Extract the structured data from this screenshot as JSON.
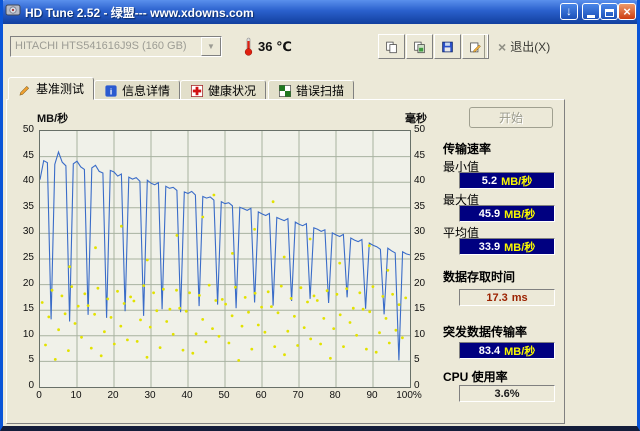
{
  "titlebar": {
    "title": "HD Tune 2.52 - 绿盟--- www.xdowns.com"
  },
  "toolbar": {
    "drive": "HITACHI HTS541616J9S (160 GB)",
    "temp": "36 ℃",
    "exit": "退出(X)"
  },
  "tabs": {
    "benchmark": "基准测试",
    "info": "信息详情",
    "health": "健康状况",
    "scan": "错误扫描"
  },
  "panel": {
    "start": "开始",
    "transfer_title": "传输速率",
    "min_label": "最小值",
    "min_value": "5.2",
    "min_unit": "MB/秒",
    "max_label": "最大值",
    "max_value": "45.9",
    "max_unit": "MB/秒",
    "avg_label": "平均值",
    "avg_value": "33.9",
    "avg_unit": "MB/秒",
    "access_label": "数据存取时间",
    "access_value": "17.3",
    "access_unit": "ms",
    "burst_label": "突发数据传输率",
    "burst_value": "83.4",
    "burst_unit": "MB/秒",
    "cpu_label": "CPU 使用率",
    "cpu_value": "3.6%"
  },
  "chart_data": {
    "type": "line",
    "title": "HD Tune benchmark: transfer rate line (MB/s, left axis) with access-time scatter (ms, right axis)",
    "left_axis_label": "MB/秒",
    "right_axis_label": "毫秒",
    "y_min": 0,
    "y_max": 50,
    "y_ticks": [
      50,
      45,
      40,
      35,
      30,
      25,
      20,
      15,
      10,
      5,
      0
    ],
    "x_min": 0,
    "x_max": 100,
    "x_tick_labels": [
      "0",
      "10",
      "20",
      "30",
      "40",
      "50",
      "60",
      "70",
      "80",
      "90",
      "100%"
    ],
    "grid": true,
    "plot_bg": "#f0f1e9",
    "grid_color": "#a8b2a0",
    "series": [
      {
        "name": "传输速率 (MB/秒)",
        "type": "line",
        "color": "#3a6cc8",
        "x_start": 0,
        "x_step": 1,
        "values": [
          40.5,
          44.2,
          43.8,
          13.2,
          43.5,
          45.9,
          43.9,
          43.2,
          12.8,
          43.6,
          44.1,
          43.0,
          42.5,
          14.1,
          42.8,
          43.3,
          42.1,
          41.8,
          13.5,
          42.3,
          42.0,
          41.2,
          41.6,
          14.8,
          41.0,
          40.6,
          40.9,
          40.2,
          13.9,
          40.4,
          39.8,
          39.5,
          39.9,
          15.2,
          39.2,
          38.8,
          39.0,
          38.4,
          14.6,
          38.1,
          37.8,
          38.2,
          37.5,
          15.8,
          37.2,
          36.9,
          37.1,
          36.5,
          16.1,
          36.2,
          35.8,
          36.0,
          35.4,
          15.4,
          35.1,
          34.8,
          34.5,
          34.9,
          16.5,
          34.2,
          33.8,
          33.5,
          33.9,
          15.9,
          33.1,
          32.8,
          32.5,
          32.9,
          16.8,
          32.2,
          31.8,
          31.5,
          31.9,
          17.2,
          31.1,
          30.8,
          30.4,
          30.7,
          16.4,
          30.1,
          29.7,
          29.4,
          29.8,
          17.5,
          29.1,
          28.7,
          28.4,
          28.8,
          15.3,
          28.1,
          27.7,
          27.4,
          26.9,
          14.2,
          27.1,
          26.6,
          26.2,
          5.2,
          26.4,
          26.0,
          25.8
        ]
      },
      {
        "name": "存取时间 (毫秒)",
        "type": "scatter",
        "color": "#e2e200",
        "x_start": 0.6,
        "x_step": 0.885,
        "values": [
          16.5,
          8.2,
          13.7,
          18.9,
          5.4,
          11.2,
          17.8,
          14.3,
          7.1,
          19.6,
          12.4,
          15.8,
          9.7,
          18.2,
          15.9,
          7.6,
          14.2,
          19.3,
          6.1,
          10.8,
          17.2,
          13.6,
          8.4,
          18.7,
          11.9,
          16.3,
          9.2,
          17.6,
          16.8,
          8.9,
          13.1,
          19.8,
          5.8,
          11.7,
          18.4,
          14.9,
          7.7,
          19.1,
          12.8,
          15.2,
          10.3,
          18.9,
          15.4,
          7.2,
          14.8,
          18.4,
          6.6,
          10.4,
          17.9,
          13.2,
          8.8,
          19.9,
          11.4,
          16.9,
          9.9,
          17.1,
          16.2,
          8.6,
          13.9,
          19.5,
          5.2,
          11.9,
          17.5,
          14.6,
          7.4,
          18.3,
          12.1,
          15.6,
          10.7,
          18.6,
          15.7,
          7.9,
          14.5,
          19.7,
          6.3,
          10.9,
          17.3,
          13.8,
          8.1,
          19.4,
          11.6,
          16.6,
          9.4,
          17.8,
          16.9,
          8.4,
          13.4,
          18.8,
          5.6,
          11.4,
          18.1,
          14.1,
          7.9,
          19.2,
          12.6,
          15.4,
          10.1,
          18.4,
          15.2,
          7.4,
          14.7,
          19.6,
          6.8,
          10.6,
          17.7,
          13.4,
          8.6,
          18.1,
          11.1,
          16.1,
          9.6,
          17.4
        ],
        "extra_points": [
          [
            8,
            23.5
          ],
          [
            15,
            27.2
          ],
          [
            22,
            31.4
          ],
          [
            29,
            24.8
          ],
          [
            37,
            29.6
          ],
          [
            44,
            33.2
          ],
          [
            47,
            37.5
          ],
          [
            52,
            26.1
          ],
          [
            58,
            30.8
          ],
          [
            63,
            36.2
          ],
          [
            66,
            25.4
          ],
          [
            73,
            28.9
          ],
          [
            81,
            24.2
          ],
          [
            89,
            27.6
          ],
          [
            94,
            22.8
          ]
        ]
      }
    ]
  }
}
